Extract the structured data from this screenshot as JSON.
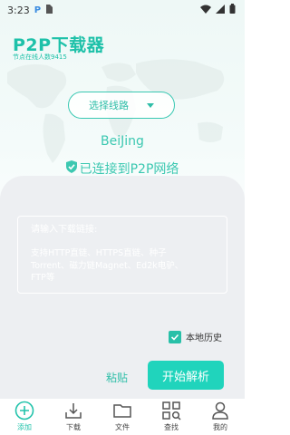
{
  "status_bar": {
    "time": "3:23",
    "app_glyph": "P"
  },
  "header": {
    "title": "P2P下载器",
    "node_count": "节点在线人数9415"
  },
  "route": {
    "label": "选择线路"
  },
  "connection": {
    "city": "BeiJing",
    "status": "已连接到P2P网络"
  },
  "input": {
    "label": "请输入下载链接:",
    "placeholder": "支持HTTP直链、HTTPS直链、种子\nTorrent、磁力链Magnet、Ed2k电驴、\nFTP等"
  },
  "history": {
    "label": "本地历史",
    "checked": true
  },
  "actions": {
    "paste": "粘贴",
    "parse": "开始解析"
  },
  "nav": {
    "items": [
      {
        "label": "添加",
        "icon": "add-icon"
      },
      {
        "label": "下载",
        "icon": "download-icon"
      },
      {
        "label": "文件",
        "icon": "folder-icon"
      },
      {
        "label": "查找",
        "icon": "grid-search-icon"
      },
      {
        "label": "我的",
        "icon": "profile-icon"
      }
    ]
  },
  "colors": {
    "accent": "#20d4bc",
    "sheet": "#edeff2",
    "text": "#333333"
  }
}
